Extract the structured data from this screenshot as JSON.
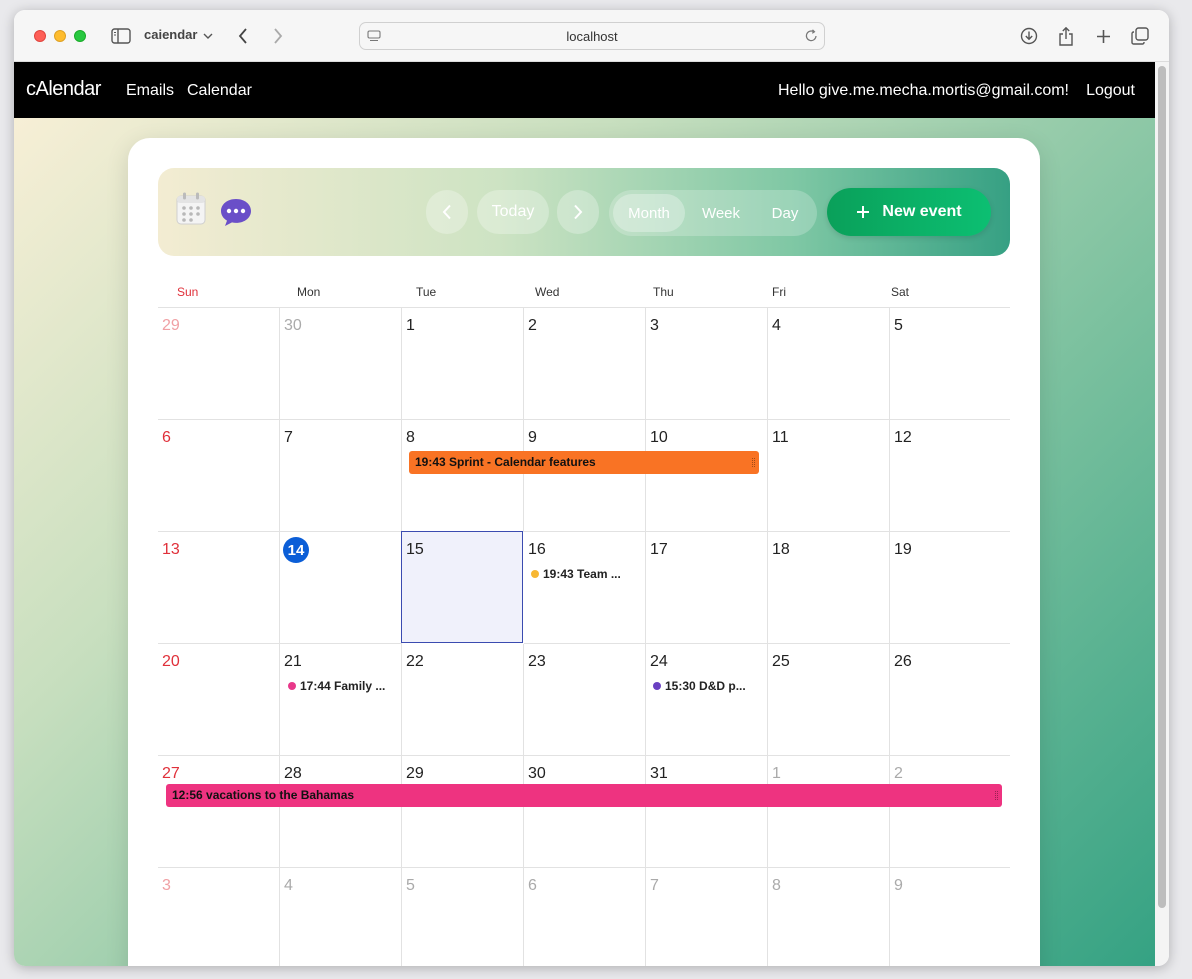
{
  "browser": {
    "tab_title": "caiendar",
    "url": "localhost"
  },
  "nav": {
    "brand": "cAlendar",
    "links": [
      "Emails",
      "Calendar"
    ],
    "greeting": "Hello give.me.mecha.mortis@gmail.com!",
    "logout": "Logout"
  },
  "toolbar": {
    "today": "Today",
    "views": [
      "Month",
      "Week",
      "Day"
    ],
    "active_view": "Month",
    "new_event": "New event"
  },
  "calendar": {
    "weekdays": [
      "Sun",
      "Mon",
      "Tue",
      "Wed",
      "Thu",
      "Fri",
      "Sat"
    ],
    "weeks": [
      [
        "29",
        "30",
        "1",
        "2",
        "3",
        "4",
        "5"
      ],
      [
        "6",
        "7",
        "8",
        "9",
        "10",
        "11",
        "12"
      ],
      [
        "13",
        "14",
        "15",
        "16",
        "17",
        "18",
        "19"
      ],
      [
        "20",
        "21",
        "22",
        "23",
        "24",
        "25",
        "26"
      ],
      [
        "27",
        "28",
        "29",
        "30",
        "31",
        "1",
        "2"
      ],
      [
        "3",
        "4",
        "5",
        "6",
        "7",
        "8",
        "9"
      ]
    ],
    "today": "14",
    "selected": "15",
    "events": {
      "sprint": "19:43 Sprint - Calendar features",
      "team": "19:43 Team ...",
      "family": "17:44 Family ...",
      "dnd": "15:30 D&D p...",
      "vacation": "12:56 vacations to the Bahamas"
    },
    "colors": {
      "sprint": "#f97324",
      "team": "#f7b733",
      "family": "#e8388a",
      "dnd": "#6a40c2",
      "vacation": "#ee3380",
      "today": "#0b5ed7",
      "sunday": "#e0303a"
    }
  }
}
